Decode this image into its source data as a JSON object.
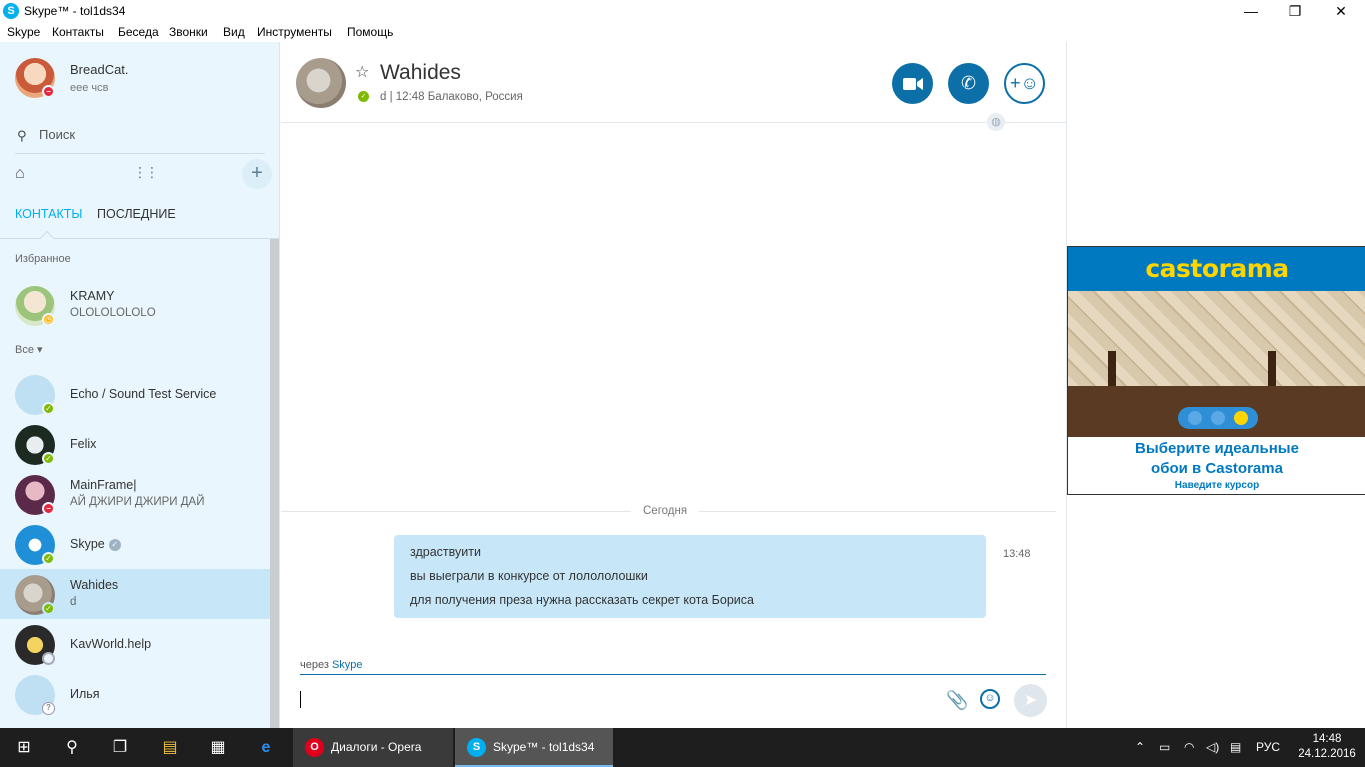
{
  "window": {
    "title": "Skype™ - tol1ds34",
    "app_icon": "S",
    "minimize": "—",
    "maximize": "❐",
    "close": "✕"
  },
  "menu": [
    "Skype",
    "Контакты",
    "Беседа",
    "Звонки",
    "Вид",
    "Инструменты",
    "Помощь"
  ],
  "profile": {
    "name": "BreadCat.",
    "mood": "еее чсв",
    "status": "busy"
  },
  "search": {
    "placeholder": "Поиск"
  },
  "tabs": {
    "contacts": "КОНТАКТЫ",
    "recent": "ПОСЛЕДНИЕ"
  },
  "sections": {
    "favorites": "Избранное",
    "all": "Все ▾"
  },
  "favorites": [
    {
      "name": "KRAMY",
      "mood": "OLOLOLOLOLO",
      "status": "away"
    }
  ],
  "contacts": [
    {
      "name": "Echo / Sound Test Service",
      "mood": "",
      "status": "online"
    },
    {
      "name": "Felix",
      "mood": "",
      "status": "online"
    },
    {
      "name": "MainFrame|",
      "mood": "АЙ ДЖИРИ ДЖИРИ ДАЙ",
      "status": "busy"
    },
    {
      "name": "Skype",
      "mood": "",
      "status": "online",
      "verified": true
    },
    {
      "name": "Wahides",
      "mood": "d",
      "status": "online",
      "selected": true
    },
    {
      "name": "KavWorld.help",
      "mood": "",
      "status": "offline"
    },
    {
      "name": "Илья",
      "mood": "",
      "status": "unknown"
    }
  ],
  "conversation": {
    "name": "Wahides",
    "info": "d  |  12:48 Балаково, Россия",
    "buttons": {
      "video": "video-call",
      "call": "voice-call",
      "add": "add-people"
    },
    "date_separator": "Сегодня",
    "message": {
      "time": "13:48",
      "lines": [
        "здраствуити",
        "вы выеграли в конкурсе от лолололошки",
        "для получения преза нужна рассказать секрет кота Бориса"
      ]
    },
    "via_prefix": "через",
    "via_service": "Skype"
  },
  "ad": {
    "brand": "castorama",
    "headline_1": "Выберите идеальные",
    "headline_2": "обои в Castorama",
    "cta": "Наведите курсор",
    "colors": {
      "brand_blue": "#0079c1",
      "brand_yellow": "#ffd500"
    }
  },
  "taskbar": {
    "apps": [
      {
        "label": "Диалоги - Opera",
        "icon": "opera-icon"
      },
      {
        "label": "Skype™ - tol1ds34",
        "icon": "skype-icon"
      }
    ],
    "language": "РУС",
    "time": "14:48",
    "date": "24.12.2016"
  },
  "colors": {
    "accent": "#00aff0",
    "dark_blue": "#0c6fa8",
    "sidebar_bg": "#eaf6fd",
    "bubble": "#c7e7f9"
  }
}
